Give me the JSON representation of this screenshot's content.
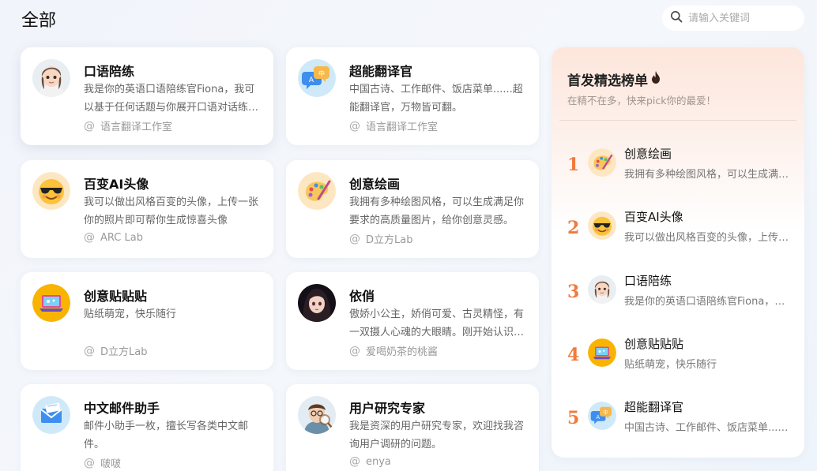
{
  "header": {
    "title": "全部",
    "search_placeholder": "请输入关键词"
  },
  "cards": [
    {
      "title": "口语陪练",
      "desc": "我是你的英语口语陪练官Fiona，我可以基于任何话题与你展开口语对话练习。",
      "author": "语言翻译工作室",
      "icon": "girl-avatar-icon"
    },
    {
      "title": "超能翻译官",
      "desc": "中国古诗、工作邮件、饭店菜单......超能翻译官，万物皆可翻。",
      "author": "语言翻译工作室",
      "icon": "translate-bubbles-icon"
    },
    {
      "title": "百变AI头像",
      "desc": "我可以做出风格百变的头像，上传一张你的照片即可帮你生成惊喜头像",
      "author": "ARC Lab",
      "icon": "sunglasses-emoji-icon"
    },
    {
      "title": "创意绘画",
      "desc": "我拥有多种绘图风格，可以生成满足你要求的高质量图片，给你创意灵感。",
      "author": "D立方Lab",
      "icon": "palette-icon"
    },
    {
      "title": "创意贴贴贴",
      "desc": "贴纸萌宠，快乐随行",
      "author": "D立方Lab",
      "icon": "sticker-laptop-icon"
    },
    {
      "title": "依俏",
      "desc": "傲娇小公主，娇俏可爱、古灵精怪，有一双摄人心魂的大眼睛。刚开始认识时有点高冷。",
      "author": "爱喝奶茶的桃酱",
      "icon": "anime-girl-avatar-icon"
    },
    {
      "title": "中文邮件助手",
      "desc": "邮件小助手一枚，擅长写各类中文邮件。",
      "author": "啵啵",
      "icon": "envelope-icon"
    },
    {
      "title": "用户研究专家",
      "desc": "我是资深的用户研究专家，欢迎找我咨询用户调研的问题。",
      "author": "enya",
      "icon": "researcher-magnifier-icon"
    }
  ],
  "ranking": {
    "title": "首发精选榜单",
    "subtitle": "在精不在多，快来pick你的最爱！",
    "items": [
      {
        "rank": "1",
        "title": "创意绘画",
        "desc": "我拥有多种绘图风格，可以生成满足你要求的高质量图片",
        "icon": "palette-icon"
      },
      {
        "rank": "2",
        "title": "百变AI头像",
        "desc": "我可以做出风格百变的头像，上传一张你的照片",
        "icon": "sunglasses-emoji-icon"
      },
      {
        "rank": "3",
        "title": "口语陪练",
        "desc": "我是你的英语口语陪练官Fiona，我可以基于任何话题",
        "icon": "girl-avatar-icon"
      },
      {
        "rank": "4",
        "title": "创意贴贴贴",
        "desc": "贴纸萌宠，快乐随行",
        "icon": "sticker-laptop-icon"
      },
      {
        "rank": "5",
        "title": "超能翻译官",
        "desc": "中国古诗、工作邮件、饭店菜单......超能翻译官",
        "icon": "translate-bubbles-icon"
      }
    ]
  },
  "colors": {
    "rank_number": "#f07a3c",
    "card_bg": "#ffffff",
    "page_bg": "#f2f4fb"
  }
}
